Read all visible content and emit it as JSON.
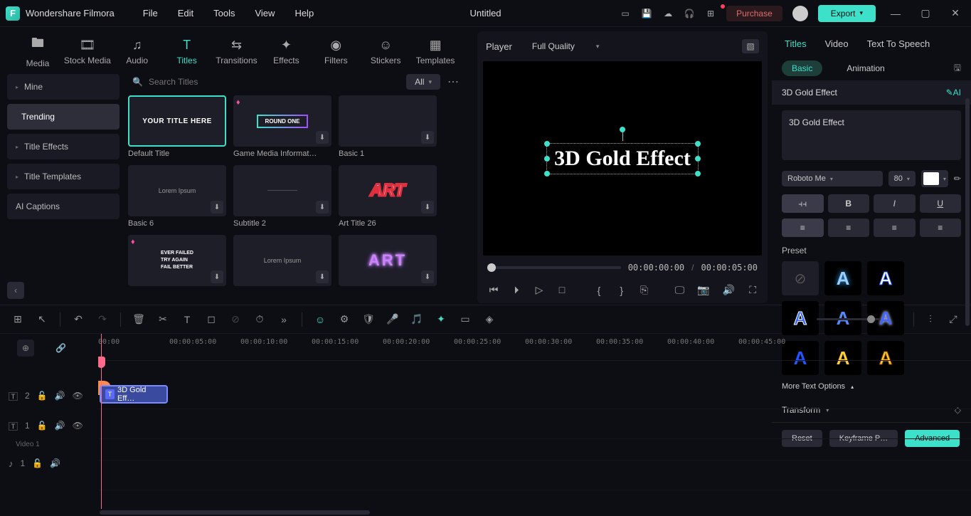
{
  "app_name": "Wondershare Filmora",
  "menu": [
    "File",
    "Edit",
    "Tools",
    "View",
    "Help"
  ],
  "document_title": "Untitled",
  "purchase_label": "Purchase",
  "export_label": "Export",
  "nav_tabs": [
    {
      "label": "Media"
    },
    {
      "label": "Stock Media"
    },
    {
      "label": "Audio"
    },
    {
      "label": "Titles"
    },
    {
      "label": "Transitions"
    },
    {
      "label": "Effects"
    },
    {
      "label": "Filters"
    },
    {
      "label": "Stickers"
    },
    {
      "label": "Templates"
    }
  ],
  "nav_active": "Titles",
  "sidebar": [
    {
      "label": "Mine",
      "expandable": true
    },
    {
      "label": "Trending",
      "active": true
    },
    {
      "label": "Title Effects",
      "expandable": true
    },
    {
      "label": "Title Templates",
      "expandable": true
    },
    {
      "label": "AI Captions"
    }
  ],
  "search": {
    "placeholder": "Search Titles"
  },
  "filter_dd": "All",
  "thumbs": [
    {
      "label": "Default Title",
      "text": "YOUR TITLE HERE",
      "selected": true,
      "kind": "default"
    },
    {
      "label": "Game Media Informat…",
      "text": "ROUND ONE",
      "kind": "roundone",
      "gem": true,
      "dl": true
    },
    {
      "label": "Basic 1",
      "text": "",
      "kind": "plain",
      "dl": true
    },
    {
      "label": "Basic 6",
      "text": "Lorem Ipsum",
      "kind": "lorem",
      "dl": true
    },
    {
      "label": "Subtitle 2",
      "text": "",
      "kind": "subtitle",
      "dl": true
    },
    {
      "label": "Art Title 26",
      "text": "ART",
      "kind": "art-red",
      "dl": true
    },
    {
      "label": "",
      "text": "EVER FAILED\nTRY AGAIN\nFAIL BETTER",
      "kind": "failbetter",
      "gem": true,
      "dl": true
    },
    {
      "label": "",
      "text": "Lorem Ipsum",
      "kind": "lorem2",
      "dl": true
    },
    {
      "label": "",
      "text": "ART",
      "kind": "art-purple",
      "dl": true
    }
  ],
  "preview": {
    "label": "Player",
    "quality": "Full Quality",
    "text_content": "3D Gold Effect",
    "time_current": "00:00:00:00",
    "time_total": "00:00:05:00"
  },
  "inspector": {
    "tabs": [
      "Titles",
      "Video",
      "Text To Speech"
    ],
    "active_tab": "Titles",
    "sub_tabs": {
      "basic": "Basic",
      "animation": "Animation"
    },
    "title_name": "3D Gold Effect",
    "text_value": "3D Gold Effect",
    "font_family": "Roboto Me",
    "font_size": "80",
    "preset_label": "Preset",
    "more_text_label": "More Text Options",
    "transform_label": "Transform",
    "footer": {
      "reset": "Reset",
      "keyframe": "Keyframe P…",
      "advanced": "Advanced"
    }
  },
  "timeline": {
    "ruler": [
      "00:00",
      "00:00:05:00",
      "00:00:10:00",
      "00:00:15:00",
      "00:00:20:00",
      "00:00:25:00",
      "00:00:30:00",
      "00:00:35:00",
      "00:00:40:00",
      "00:00:45:00"
    ],
    "tracks": [
      {
        "icon": "T",
        "idx": "2",
        "sublabel": ""
      },
      {
        "icon": "T",
        "idx": "1",
        "sublabel": "Video 1"
      },
      {
        "icon": "♪",
        "idx": "1",
        "sublabel": ""
      }
    ],
    "clip_label": "3D Gold Eff…"
  }
}
